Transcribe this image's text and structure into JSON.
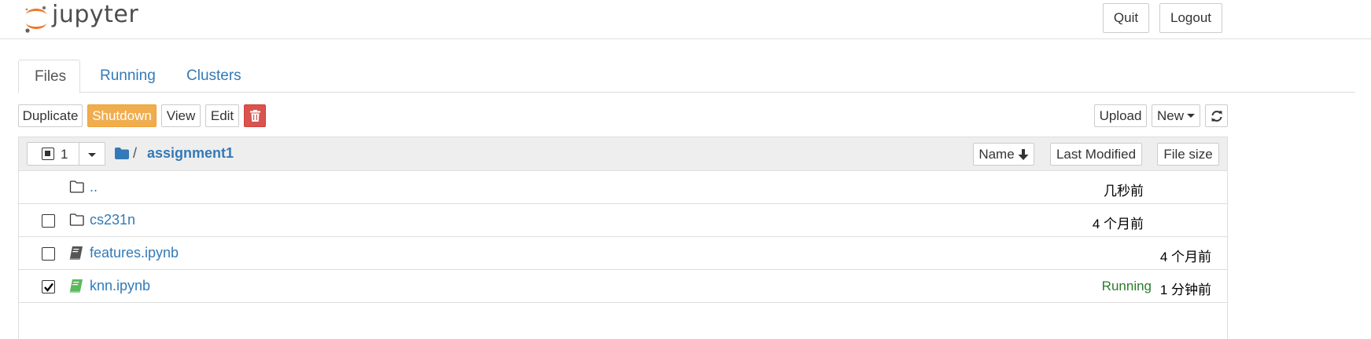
{
  "header": {
    "logo_text": "jupyter",
    "quit_label": "Quit",
    "logout_label": "Logout"
  },
  "tabs": [
    {
      "label": "Files",
      "active": true
    },
    {
      "label": "Running",
      "active": false
    },
    {
      "label": "Clusters",
      "active": false
    }
  ],
  "toolbar": {
    "duplicate_label": "Duplicate",
    "shutdown_label": "Shutdown",
    "view_label": "View",
    "edit_label": "Edit",
    "delete_icon": "trash-icon",
    "upload_label": "Upload",
    "new_label": "New",
    "refresh_icon": "refresh-icon"
  },
  "list_header": {
    "selected_count": "1",
    "folder_icon": "folder-icon",
    "path_separator": "/",
    "current_folder": "assignment1",
    "sort_name_label": "Name",
    "sort_modified_label": "Last Modified",
    "sort_size_label": "File size"
  },
  "rows": [
    {
      "name": "..",
      "type": "folder",
      "checked": false,
      "status": "",
      "modified": "几秒前"
    },
    {
      "name": "cs231n",
      "type": "folder",
      "checked": false,
      "status": "",
      "modified": "4 个月前"
    },
    {
      "name": "features.ipynb",
      "type": "notebook",
      "checked": false,
      "status": "",
      "modified": "4 个月前"
    },
    {
      "name": "knn.ipynb",
      "type": "notebook-running",
      "checked": true,
      "status": "Running",
      "modified": "1 分钟前"
    }
  ],
  "colors": {
    "link": "#337ab7",
    "shutdown": "#f0ad4e",
    "delete": "#d9534f",
    "running": "#2a7d2a",
    "logo_orange": "#f37726"
  }
}
